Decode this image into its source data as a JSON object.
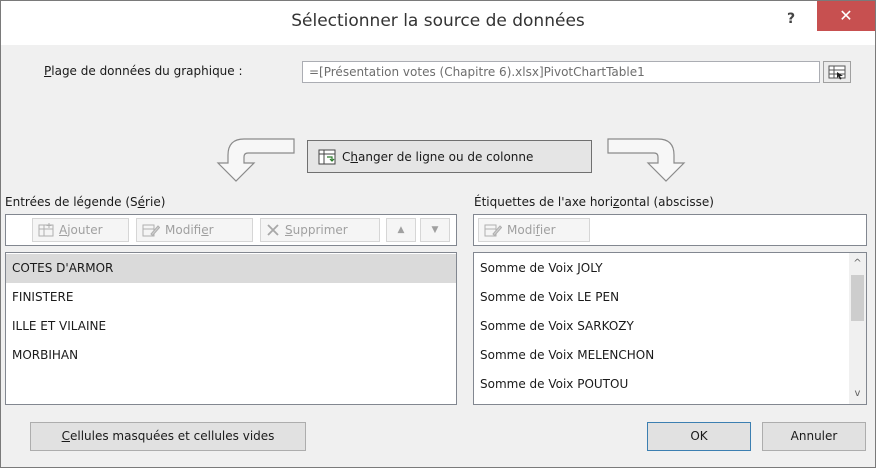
{
  "window": {
    "title": "Sélectionner la source de données",
    "help": "?",
    "close": "✕"
  },
  "range": {
    "label_prefix": "",
    "label_u": "P",
    "label_rest": "lage de données du graphique :",
    "value": "=[Présentation votes (Chapitre 6).xlsx]PivotChartTable1"
  },
  "switch": {
    "label_a": "C",
    "label_u": "h",
    "label_b": "anger de ligne ou de colonne"
  },
  "series": {
    "heading_a": "Entrées de légende (S",
    "heading_u": "é",
    "heading_b": "rie)",
    "toolbar": {
      "add_u": "A",
      "add_rest": "jouter",
      "edit_a": "Modifi",
      "edit_u": "e",
      "edit_b": "r",
      "delete_u": "S",
      "delete_rest": "upprimer",
      "up": "▲",
      "down": "▼"
    },
    "items": [
      "COTES D'ARMOR",
      "FINISTERE",
      "ILLE ET VILAINE",
      "MORBIHAN"
    ],
    "selected_index": 0
  },
  "categories": {
    "heading_a": "Étiquettes de l'axe hori",
    "heading_u": "z",
    "heading_b": "ontal (abscisse)",
    "edit_a": "Modi",
    "edit_u": "f",
    "edit_b": "ier",
    "items": [
      "Somme de Voix JOLY",
      "Somme de Voix LE PEN",
      "Somme de Voix SARKOZY",
      "Somme de Voix MELENCHON",
      "Somme de Voix POUTOU"
    ],
    "scroll_up": "^",
    "scroll_down": "v"
  },
  "footer": {
    "hidden_u": "C",
    "hidden_rest": "ellules masquées et cellules vides",
    "ok": "OK",
    "cancel": "Annuler"
  }
}
